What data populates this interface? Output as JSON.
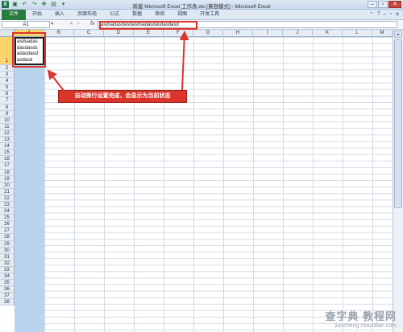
{
  "window": {
    "title": "新建 Microsoft Excel 工作表.xls [兼容模式] - Microsoft Excel",
    "quick_access": [
      "save-icon",
      "undo-icon",
      "redo-icon",
      "move-icon",
      "paste-icon",
      "dropdown-icon"
    ],
    "buttons": [
      "minimize",
      "restore",
      "close"
    ]
  },
  "ribbon": {
    "tabs": [
      "文件",
      "开始",
      "插入",
      "页面布局",
      "公式",
      "数据",
      "审阅",
      "视图",
      "开发工具"
    ]
  },
  "formula_bar": {
    "name_box": "A1",
    "fx": "fx",
    "content": "asdsadasdasdasdsadasdasdasdasd"
  },
  "sheet": {
    "columns": [
      "A",
      "B",
      "C",
      "D",
      "E",
      "F",
      "G",
      "H",
      "I",
      "J",
      "K",
      "L",
      "M"
    ],
    "rows": [
      "1",
      "2",
      "3",
      "4",
      "5",
      "6",
      "7",
      "8",
      "9",
      "10",
      "11",
      "12",
      "13",
      "14",
      "15",
      "16",
      "17",
      "18",
      "19",
      "20",
      "21",
      "22",
      "23",
      "24",
      "25",
      "26",
      "27",
      "28",
      "29",
      "30",
      "31",
      "32",
      "33",
      "34",
      "35",
      "36",
      "37",
      "38"
    ],
    "selected_cell": "A1",
    "a1_wrapped_lines": [
      "asdsadas",
      "dasdasds",
      "adasdasd",
      "asdasd"
    ]
  },
  "annotation": {
    "text": "自动换行设置完成，会显示为当前状态",
    "color": "#d9352b"
  },
  "watermark": {
    "line1": "查字典 教程网",
    "line2": "jiaocheng.chazidian.com"
  },
  "colors": {
    "selected_header": "#f9d56b",
    "column_highlight": "#b8d4ef",
    "file_tab": "#2a7b3e"
  }
}
